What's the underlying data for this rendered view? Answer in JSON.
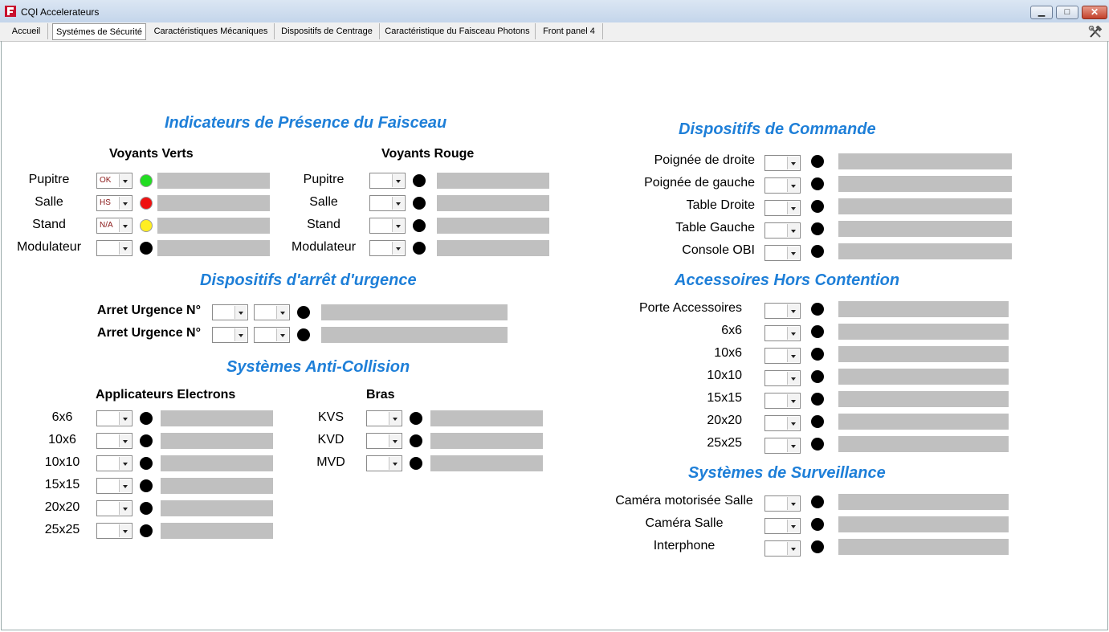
{
  "window": {
    "title": "CQI Accelerateurs"
  },
  "colors": {
    "accent_heading": "#1e7fd8",
    "field_bg": "#c0c0c0",
    "led_off": "#000000",
    "led_green": "#22dd22",
    "led_red": "#ee1111",
    "led_yellow": "#ffee22",
    "combo_text": "#8b1a1a"
  },
  "tabs": [
    {
      "label": "Accueil"
    },
    {
      "label": "Systémes de Sécurité",
      "active": true
    },
    {
      "label": "Caractéristiques Mécaniques"
    },
    {
      "label": "Dispositifs de Centrage"
    },
    {
      "label": "Caractéristique du Faisceau Photons"
    },
    {
      "label": "Front panel 4"
    }
  ],
  "icons": {
    "app": "app-logo-icon",
    "tools": "hammer-wrench-icon"
  },
  "presence": {
    "title": "Indicateurs de Présence du Faisceau",
    "green_title": "Voyants Verts",
    "red_title": "Voyants Rouge",
    "green_rows": [
      {
        "label": "Pupitre",
        "value": "OK",
        "led": "green"
      },
      {
        "label": "Salle",
        "value": "HS",
        "led": "red"
      },
      {
        "label": "Stand",
        "value": "N/A",
        "led": "yellow"
      },
      {
        "label": "Modulateur",
        "value": "",
        "led": "off"
      }
    ],
    "red_rows": [
      {
        "label": "Pupitre",
        "value": "",
        "led": "off"
      },
      {
        "label": "Salle",
        "value": "",
        "led": "off"
      },
      {
        "label": "Stand",
        "value": "",
        "led": "off"
      },
      {
        "label": "Modulateur",
        "value": "",
        "led": "off"
      }
    ]
  },
  "urgence": {
    "title": "Dispositifs d'arrêt d'urgence",
    "rows": [
      {
        "label": "Arret Urgence N°"
      },
      {
        "label": "Arret Urgence N°"
      }
    ]
  },
  "anticollision": {
    "title": "Systèmes Anti-Collision",
    "applicateurs_title": "Applicateurs Electrons",
    "bras_title": "Bras",
    "applicateurs": [
      "6x6",
      "10x6",
      "10x10",
      "15x15",
      "20x20",
      "25x25"
    ],
    "bras": [
      "KVS",
      "KVD",
      "MVD"
    ]
  },
  "commande": {
    "title": "Dispositifs de Commande",
    "rows": [
      "Poignée de droite",
      "Poignée de gauche",
      "Table Droite",
      "Table Gauche",
      "Console OBI"
    ]
  },
  "accessoires": {
    "title": "Accessoires Hors Contention",
    "rows": [
      "Porte Accessoires",
      "6x6",
      "10x6",
      "10x10",
      "15x15",
      "20x20",
      "25x25"
    ]
  },
  "surveillance": {
    "title": "Systèmes de Surveillance",
    "rows": [
      "Caméra motorisée Salle",
      "Caméra Salle",
      "Interphone"
    ]
  }
}
